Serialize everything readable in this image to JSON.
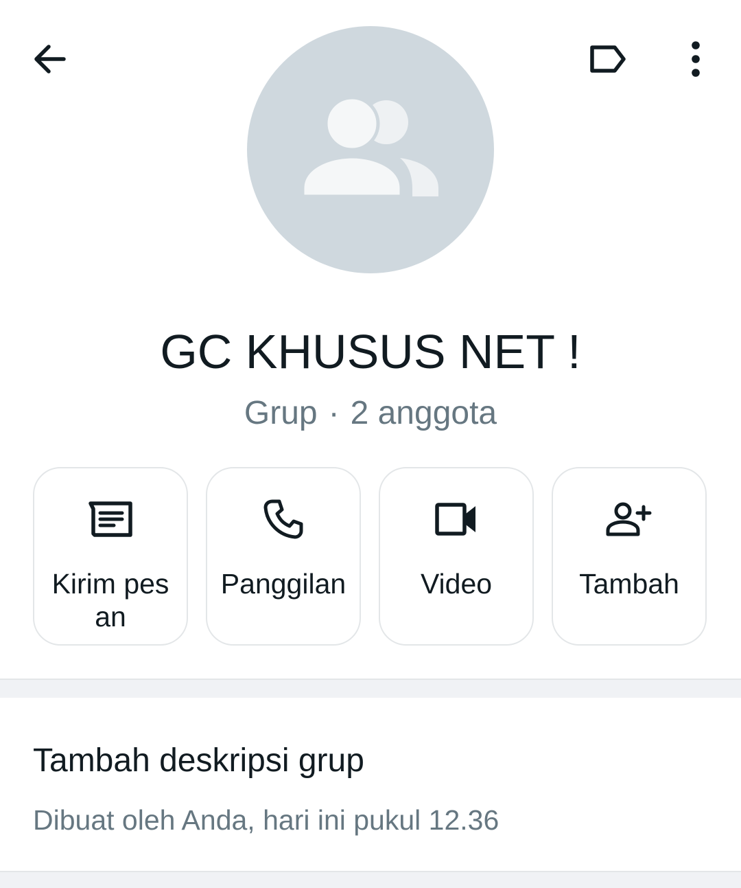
{
  "header": {
    "back_icon": "arrow-left-icon",
    "label_icon": "label-tag-icon",
    "more_icon": "more-vertical-icon"
  },
  "profile": {
    "avatar_icon": "group-avatar-icon",
    "avatar_color": "#cfd8de",
    "name": "GC KHUSUS NET !",
    "type": "Grup",
    "separator": "·",
    "members": "2 anggota"
  },
  "actions": [
    {
      "label": "Kirim pesan",
      "icon": "message-icon"
    },
    {
      "label": "Panggilan",
      "icon": "phone-icon"
    },
    {
      "label": "Video",
      "icon": "video-camera-icon"
    },
    {
      "label": "Tambah",
      "icon": "add-person-icon"
    }
  ],
  "description": {
    "title": "Tambah deskripsi grup",
    "created": "Dibuat oleh Anda, hari ini pukul 12.36"
  },
  "colors": {
    "primary_text": "#111b21",
    "secondary_text": "#667781",
    "divider": "#f0f2f5"
  }
}
